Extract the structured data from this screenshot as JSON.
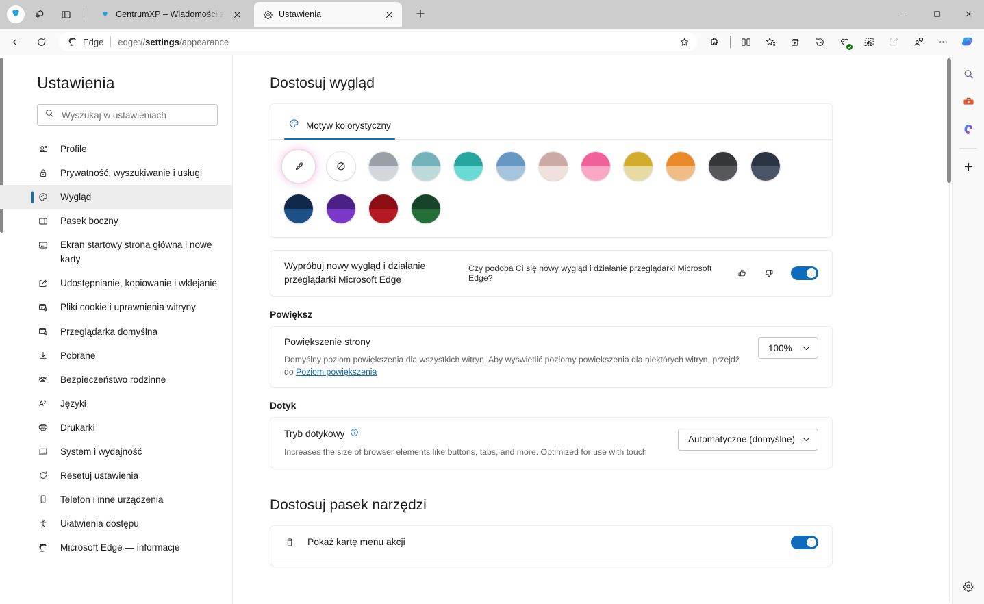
{
  "browser": {
    "window_controls": {
      "minimize": "minimize-icon",
      "maximize": "maximize-icon",
      "close": "close-icon"
    },
    "tabstrip_left_icons": [
      "profile-avatar-icon",
      "workspaces-icon",
      "vertical-tabs-icon"
    ],
    "tabs": [
      {
        "title": "CentrumXP – Wiadomości ze świa",
        "favicon": "centrumxp-favicon",
        "active": false,
        "close_label": "×"
      },
      {
        "title": "Ustawienia",
        "favicon": "settings-gear-favicon",
        "active": true,
        "close_label": "×"
      }
    ],
    "new_tab_label": "+",
    "nav": {
      "back": "back-arrow-icon",
      "refresh": "refresh-icon"
    },
    "omnibox": {
      "brand_label": "Edge",
      "url_prefix": "edge://",
      "url_bold": "settings",
      "url_suffix": "/appearance",
      "full_url": "edge://settings/appearance",
      "favorite_icon": "star-outline-icon"
    },
    "toolbar_right_icons": [
      "extensions-puzzle-icon",
      "split-screen-icon",
      "favorites-star-icon",
      "collections-icon",
      "history-icon",
      "shopping-heart-check-icon",
      "web-capture-scissors-icon",
      "share-icon",
      "profile-people-icon",
      "settings-and-more-ellipsis-icon"
    ],
    "copilot_icon": "copilot-icon",
    "sidebar_icons": [
      "search-icon",
      "tools-toolbox-icon",
      "microsoft-365-icon",
      "add-sidebar-app-icon"
    ],
    "sidebar_bottom_icon": "sidebar-settings-gear-icon"
  },
  "settings": {
    "title": "Ustawienia",
    "search": {
      "placeholder": "Wyszukaj w ustawieniach",
      "value": "",
      "icon": "search-icon"
    },
    "nav_items": [
      {
        "label": "Profile",
        "icon": "profile-icon",
        "selected": false
      },
      {
        "label": "Prywatność, wyszukiwanie i usługi",
        "icon": "lock-icon",
        "selected": false
      },
      {
        "label": "Wygląd",
        "icon": "palette-icon",
        "selected": true
      },
      {
        "label": "Pasek boczny",
        "icon": "sidebar-icon",
        "selected": false
      },
      {
        "label": "Ekran startowy strona główna i nowe karty",
        "icon": "start-page-icon",
        "selected": false
      },
      {
        "label": "Udostępnianie, kopiowanie i wklejanie",
        "icon": "share-copy-paste-icon",
        "selected": false
      },
      {
        "label": "Pliki cookie i uprawnienia witryny",
        "icon": "cookies-icon",
        "selected": false
      },
      {
        "label": "Przeglądarka domyślna",
        "icon": "default-browser-icon",
        "selected": false
      },
      {
        "label": "Pobrane",
        "icon": "download-icon",
        "selected": false
      },
      {
        "label": "Bezpieczeństwo rodzinne",
        "icon": "family-safety-icon",
        "selected": false
      },
      {
        "label": "Języki",
        "icon": "languages-icon",
        "selected": false
      },
      {
        "label": "Drukarki",
        "icon": "printer-icon",
        "selected": false
      },
      {
        "label": "System i wydajność",
        "icon": "system-performance-icon",
        "selected": false
      },
      {
        "label": "Resetuj ustawienia",
        "icon": "reset-icon",
        "selected": false
      },
      {
        "label": "Telefon i inne urządzenia",
        "icon": "phone-icon",
        "selected": false
      },
      {
        "label": "Ułatwienia dostępu",
        "icon": "accessibility-icon",
        "selected": false
      },
      {
        "label": "Microsoft Edge — informacje",
        "icon": "edge-logo-icon",
        "selected": false
      }
    ]
  },
  "main": {
    "page_title": "Dostosuj wygląd",
    "theme": {
      "tab_label": "Motyw kolorystyczny",
      "tab_icon": "palette-icon",
      "swatches": [
        {
          "name": "custom-color-picker",
          "type": "picker",
          "icon": "eyedropper-icon"
        },
        {
          "name": "no-theme",
          "type": "none",
          "icon": "no-color-icon"
        },
        {
          "name": "gray",
          "top": "#9aa0a8",
          "bottom": "#d3d6da"
        },
        {
          "name": "pale-teal",
          "top": "#74b2b9",
          "bottom": "#bcdada"
        },
        {
          "name": "teal",
          "top": "#27a6a0",
          "bottom": "#69dbd4"
        },
        {
          "name": "blue",
          "top": "#6798c4",
          "bottom": "#a7c4de"
        },
        {
          "name": "rose",
          "top": "#cba9a4",
          "bottom": "#efe1de"
        },
        {
          "name": "pink",
          "top": "#f2609a",
          "bottom": "#f9a7c4"
        },
        {
          "name": "gold",
          "top": "#d3ac2b",
          "bottom": "#e7dba4"
        },
        {
          "name": "orange",
          "top": "#e98a28",
          "bottom": "#f2bd84"
        },
        {
          "name": "dark-gray",
          "top": "#35363a",
          "bottom": "#56585c"
        },
        {
          "name": "slate",
          "top": "#2b3442",
          "bottom": "#4b5568"
        },
        {
          "name": "navy",
          "top": "#112948",
          "bottom": "#1d4f87"
        },
        {
          "name": "purple",
          "top": "#4b2186",
          "bottom": "#7a38c8"
        },
        {
          "name": "red",
          "top": "#8c0f16",
          "bottom": "#b51924"
        },
        {
          "name": "green",
          "top": "#17432a",
          "bottom": "#256e38"
        }
      ]
    },
    "new_look": {
      "title": "Wypróbuj nowy wygląd i działanie przeglądarki Microsoft Edge",
      "question": "Czy podoba Ci się nowy wygląd i działanie przeglądarki Microsoft Edge?",
      "thumbs_up_icon": "thumbs-up-icon",
      "thumbs_down_icon": "thumbs-down-icon",
      "toggle_state": "on"
    },
    "zoom_section": {
      "heading": "Powiększ",
      "row_title": "Powiększenie strony",
      "description_before": "Domyślny poziom powiększenia dla wszystkich witryn. Aby wyświetlić poziomy powiększenia dla niektórych witryn, przejdź do ",
      "link_text": "Poziom powiększenia",
      "select_value": "100%"
    },
    "touch_section": {
      "heading": "Dotyk",
      "row_title": "Tryb dotykowy",
      "help_icon": "help-circle-icon",
      "description": "Increases the size of browser elements like buttons, tabs, and more. Optimized for use with touch",
      "select_value": "Automatyczne (domyślne)"
    },
    "toolbar_section": {
      "heading": "Dostosuj pasek narzędzi",
      "row_title": "Pokaż kartę menu akcji",
      "row_icon": "action-menu-card-icon",
      "toggle_state": "on"
    }
  },
  "colors": {
    "accent": "#0f6cbd",
    "chrome_bg": "#cdcdcd",
    "toolbar_bg": "#f9f9f9",
    "card_border": "#ededed",
    "selected_nav_bg": "#ededed"
  }
}
